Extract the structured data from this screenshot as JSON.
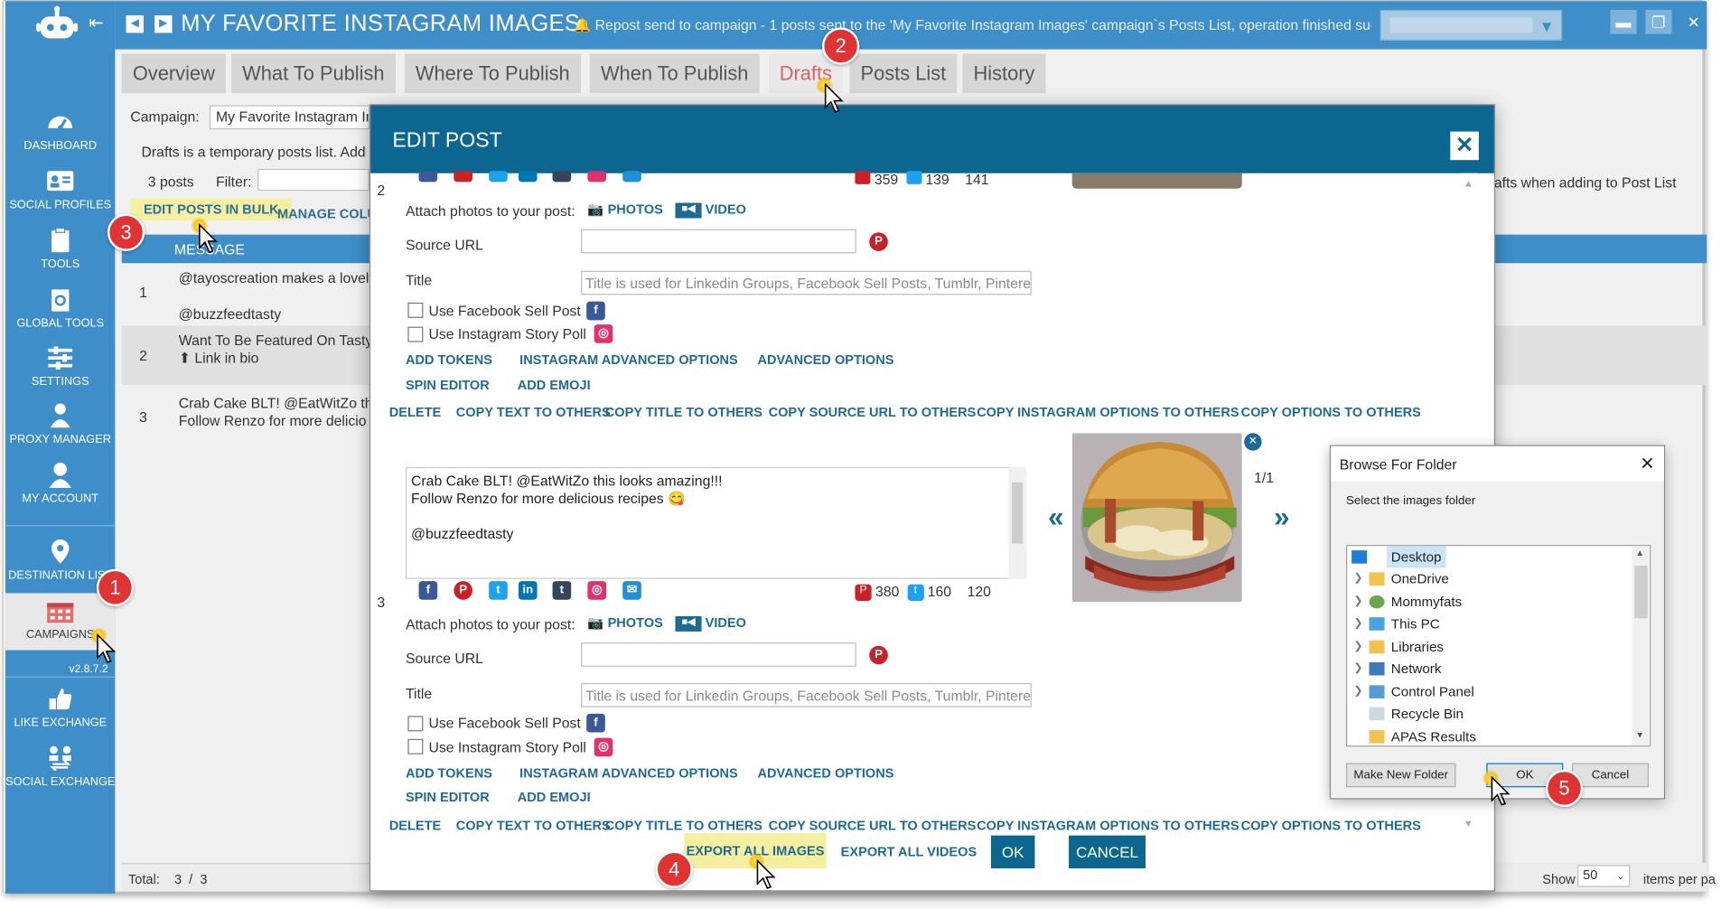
{
  "app": {
    "title": "MY FAVORITE INSTAGRAM IMAGES",
    "notification": "Repost send to campaign - 1 posts sent to the 'My Favorite Instagram Images' campaign`s Posts List, operation finished suc",
    "version": "v2.8.7.2"
  },
  "sidebar": {
    "items": [
      {
        "label": "DASHBOARD",
        "icon": "dashboard-icon"
      },
      {
        "label": "SOCIAL PROFILES",
        "icon": "social-profiles-icon"
      },
      {
        "label": "TOOLS",
        "icon": "tools-icon"
      },
      {
        "label": "GLOBAL TOOLS",
        "icon": "global-tools-icon"
      },
      {
        "label": "SETTINGS",
        "icon": "settings-icon"
      },
      {
        "label": "PROXY MANAGER",
        "icon": "proxy-manager-icon"
      },
      {
        "label": "MY ACCOUNT",
        "icon": "account-icon"
      },
      {
        "label": "DESTINATION LIST",
        "icon": "location-pin-icon"
      },
      {
        "label": "CAMPAIGNS",
        "icon": "calendar-icon"
      },
      {
        "label": "LIKE EXCHANGE",
        "icon": "like-exchange-icon"
      },
      {
        "label": "SOCIAL EXCHANGE",
        "icon": "social-exchange-icon"
      }
    ]
  },
  "tabs": [
    "Overview",
    "What To Publish",
    "Where To Publish",
    "When To Publish",
    "Drafts",
    "Posts List",
    "History"
  ],
  "campaign": {
    "label": "Campaign:",
    "value": "My Favorite Instagram Im",
    "description": "Drafts is a temporary posts list. Add",
    "description_right": "afts when adding to Post List",
    "posts_count": "3 posts",
    "filter_label": "Filter:",
    "edit_bulk": "EDIT POSTS IN BULK",
    "manage_columns": "MANAGE COLU",
    "column_message": "MESSAGE"
  },
  "drafts": [
    {
      "num": "1",
      "line1": "@tayoscreation makes a lovely",
      "line2": "@buzzfeedtasty"
    },
    {
      "num": "2",
      "line1": "Want To Be Featured On Tasty",
      "line2": "⬆ Link in bio"
    },
    {
      "num": "3",
      "line1": "Crab Cake BLT! @EatWitZo this",
      "line2": "Follow Renzo for more delicio"
    }
  ],
  "footer": {
    "total_label": "Total:",
    "total_a": "3",
    "sep": "/",
    "total_b": "3",
    "show_label": "Show",
    "show_value": "50",
    "per_page": "items per pa"
  },
  "modal": {
    "title": "EDIT POST",
    "post2": {
      "num": "2",
      "stats": {
        "pinterest": "359",
        "twitter": "139",
        "third": "141"
      }
    },
    "post3": {
      "num": "3",
      "text_line1": "Crab Cake BLT! @EatWitZo this looks amazing!!!",
      "text_line2": "Follow Renzo for more delicious recipes 😋",
      "text_line3": "@buzzfeedtasty",
      "stats": {
        "pinterest": "380",
        "twitter": "160",
        "third": "120"
      },
      "image_counter": "1/1"
    },
    "attach_label": "Attach photos to your post:",
    "photos": "PHOTOS",
    "video": "VIDEO",
    "source_url": "Source URL",
    "title_label": "Title",
    "title_placeholder": "Title is used for Linkedin Groups, Facebook Sell Posts, Tumblr, Pinterest",
    "fb_sell": "Use Facebook Sell Post",
    "ig_poll": "Use Instagram Story Poll",
    "add_tokens": "ADD TOKENS",
    "ig_advanced": "INSTAGRAM ADVANCED OPTIONS",
    "advanced": "ADVANCED OPTIONS",
    "spin_editor": "SPIN EDITOR",
    "add_emoji": "ADD EMOJI",
    "actions": [
      "DELETE",
      "COPY TEXT TO OTHERS",
      "COPY TITLE TO OTHERS",
      "COPY SOURCE URL TO OTHERS",
      "COPY INSTAGRAM OPTIONS TO OTHERS",
      "COPY OPTIONS TO OTHERS"
    ],
    "export_images": "EXPORT ALL IMAGES",
    "export_videos": "EXPORT ALL VIDEOS",
    "ok": "OK",
    "cancel": "CANCEL"
  },
  "folder_dialog": {
    "title": "Browse For Folder",
    "subtitle": "Select the images folder",
    "items": [
      "Desktop",
      "OneDrive",
      "Mommyfats",
      "This PC",
      "Libraries",
      "Network",
      "Control Panel",
      "Recycle Bin",
      "APAS Results"
    ],
    "make_new": "Make New Folder",
    "ok": "OK",
    "cancel": "Cancel"
  },
  "markers": [
    "1",
    "2",
    "3",
    "4",
    "5"
  ],
  "colors": {
    "sidebar": "#3d8ec9",
    "modal_header": "#0b6690",
    "link": "#1e6a96",
    "highlight": "#f5f0a0",
    "badge": "#e03333"
  }
}
